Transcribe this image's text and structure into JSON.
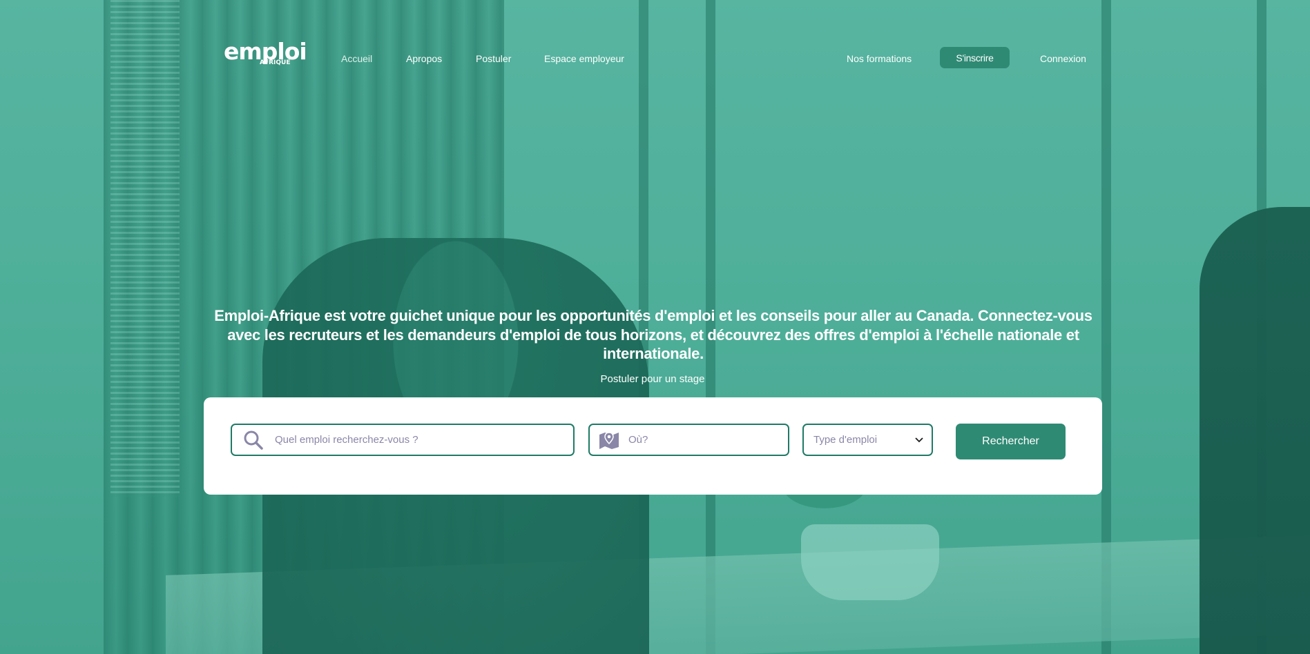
{
  "brand": {
    "logo_word": "emploi",
    "logo_sub": "AFRIQUE"
  },
  "nav": {
    "items": [
      {
        "label": "Accueil"
      },
      {
        "label": "Apropos"
      },
      {
        "label": "Postuler"
      },
      {
        "label": "Espace employeur"
      }
    ],
    "right": {
      "formations": "Nos formations",
      "signup": "S'inscrire",
      "login": "Connexion"
    }
  },
  "hero": {
    "headline": "Emploi-Afrique est votre guichet unique pour les opportunités d'emploi et les conseils pour aller au Canada. Connectez-vous avec les recruteurs et les demandeurs d'emploi de tous horizons, et découvrez des offres d'emploi à l'échelle nationale et internationale.",
    "sub": "Postuler pour un stage"
  },
  "search": {
    "keyword_placeholder": "Quel emploi recherchez-vous ?",
    "location_placeholder": "Où?",
    "type_value": "Type d'emploi",
    "submit_label": "Rechercher"
  },
  "colors": {
    "accent": "#2f8a74",
    "field_border": "#1f7a66",
    "placeholder": "#8a86a8"
  },
  "icons": {
    "keyword": "search-icon",
    "location": "map-icon",
    "type": "chevron-down-icon"
  }
}
